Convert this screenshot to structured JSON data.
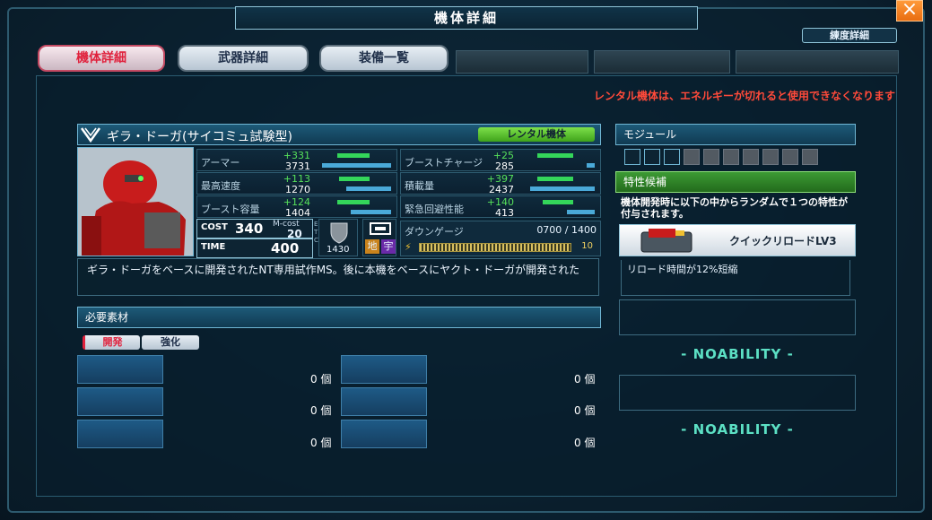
{
  "window": {
    "title": "機体詳細",
    "close_icon": "×",
    "proficiency_button": "練度詳細"
  },
  "tabs": [
    {
      "label": "機体詳細",
      "active": true
    },
    {
      "label": "武器詳細",
      "active": false
    },
    {
      "label": "装備一覧",
      "active": false
    }
  ],
  "warning": "レンタル機体は、エネルギーが切れると使用できなくなります",
  "unit": {
    "name": "ギラ・ドーガ(サイコミュ試験型)",
    "rental_badge": "レンタル機体",
    "stats": [
      {
        "label": "アーマー",
        "bonus": "+331",
        "value": "3731",
        "level": 0.85
      },
      {
        "label": "ブーストチャージ",
        "bonus": "+25",
        "value": "285",
        "level": 0.1
      },
      {
        "label": "最高速度",
        "bonus": "+113",
        "value": "1270",
        "level": 0.55
      },
      {
        "label": "積載量",
        "bonus": "+397",
        "value": "2437",
        "level": 0.8
      },
      {
        "label": "ブースト容量",
        "bonus": "+124",
        "value": "1404",
        "level": 0.5
      },
      {
        "label": "緊急回避性能",
        "bonus": "+140",
        "value": "413",
        "level": 0.35
      }
    ],
    "cost_label": "COST",
    "cost_value": "340",
    "mcost_label": "M-cost",
    "mcost_value": "20",
    "etc_label": "E T C",
    "time_label": "TIME",
    "time_value": "400",
    "shield_value": "1430",
    "terrain_ground": "地",
    "terrain_space": "宇",
    "down_label": "ダウンゲージ",
    "down_value": "0700 / 1400",
    "down_level": "10",
    "description": "ギラ・ドーガをベースに開発されたNT専用試作MS。後に本機をベースにヤクト・ドーガが開発された"
  },
  "materials": {
    "header": "必要素材",
    "tabs": [
      "開発",
      "強化"
    ],
    "left_qty": [
      "0 個",
      "0 個",
      "0 個"
    ],
    "right_qty": [
      "0 個",
      "0 個",
      "0 個"
    ]
  },
  "module": {
    "header": "モジュール",
    "open_slots": 3,
    "locked_slots": 7
  },
  "traits": {
    "header": "特性候補",
    "description": "機体開発時に以下の中からランダムで１つの特性が付与されます。",
    "skill_name": "クイックリロードLV3",
    "skill_effect": "リロード時間が12%短縮",
    "noability": [
      "- NOABILITY -",
      "- NOABILITY -"
    ]
  },
  "colors": {
    "accent": "#1d5a78",
    "warning": "#ff4a3a",
    "bonus": "#56e05a",
    "noability": "#5ce0c4"
  }
}
